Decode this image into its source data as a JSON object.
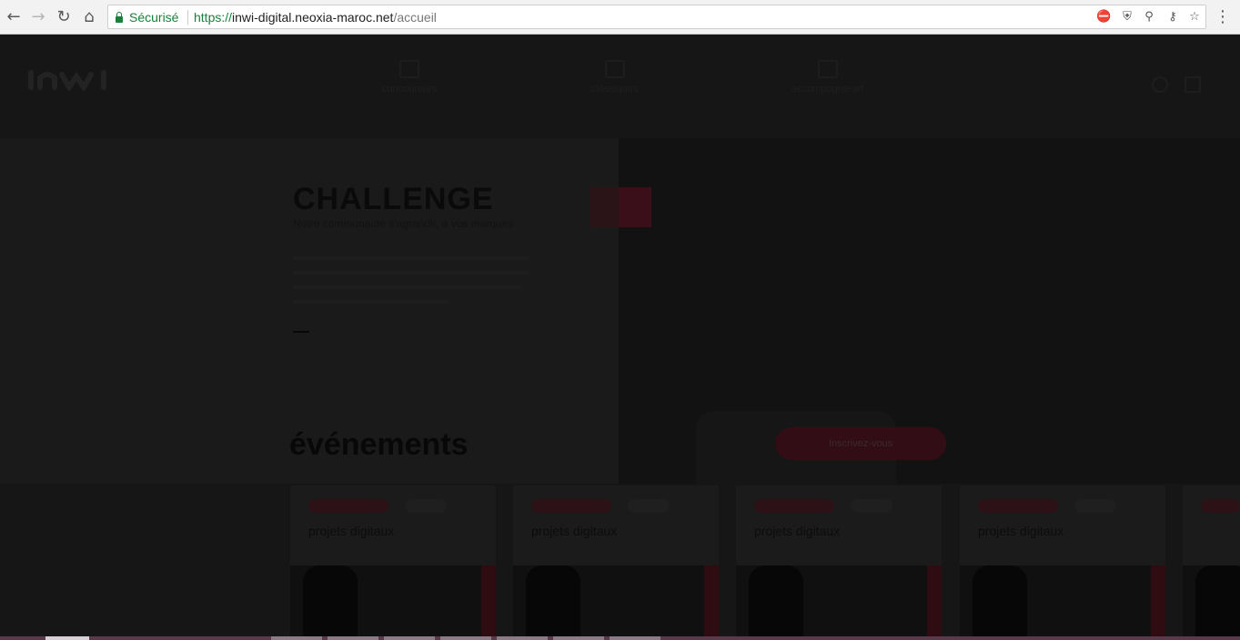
{
  "browser": {
    "back": "←",
    "forward": "→",
    "reload": "↻",
    "home": "⌂",
    "security_label": "Sécurisé",
    "url_scheme": "https://",
    "url_host": "inwi-digital.neoxia-maroc.net",
    "url_path": "/accueil",
    "menu": "⋮"
  },
  "page": {
    "nav": [
      "concoureurs",
      "classiques",
      "accompagne-art"
    ],
    "hero": {
      "title": "CHALLENGE",
      "subtitle": "Notre communauté s'agrandit, à vos marques"
    },
    "cta_label": "Inscrivez-vous",
    "events_title": "événements",
    "cards": [
      {
        "title": "projets digitaux"
      },
      {
        "title": "projets digitaux"
      },
      {
        "title": "projets digitaux"
      },
      {
        "title": "projets digitaux"
      }
    ]
  }
}
